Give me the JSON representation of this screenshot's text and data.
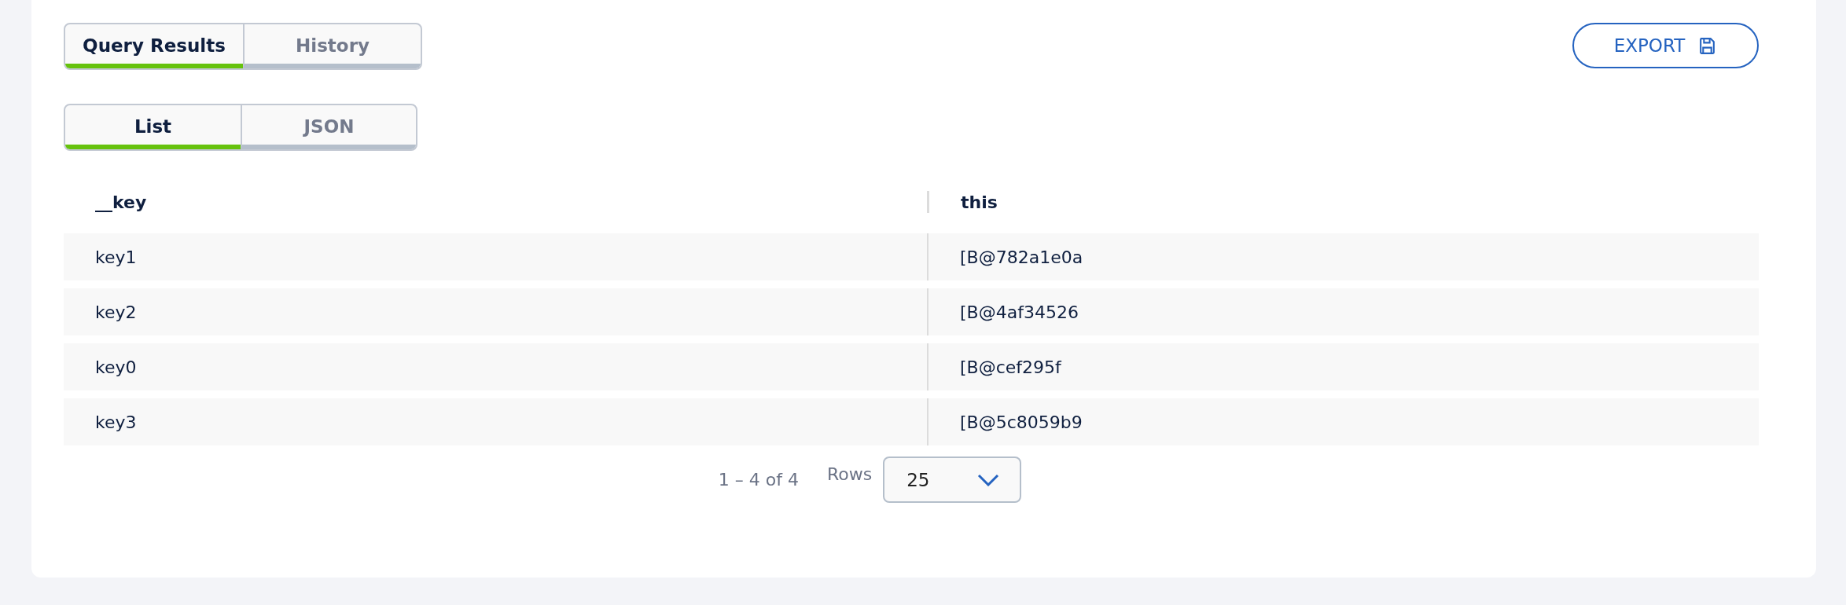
{
  "result_tabs": [
    {
      "label": "Query Results",
      "selected": true
    },
    {
      "label": "History",
      "selected": false
    }
  ],
  "export_button": {
    "label": "EXPORT"
  },
  "view_tabs": [
    {
      "label": "List",
      "selected": true
    },
    {
      "label": "JSON",
      "selected": false
    }
  ],
  "table": {
    "columns": [
      "__key",
      "this"
    ],
    "rows": [
      [
        "key1",
        "[B@782a1e0a"
      ],
      [
        "key2",
        "[B@4af34526"
      ],
      [
        "key0",
        "[B@cef295f"
      ],
      [
        "key3",
        "[B@5c8059b9"
      ]
    ]
  },
  "pagination": {
    "range": "1 – 4 of 4",
    "rows_label": "Rows",
    "rows_per_page": "25"
  }
}
